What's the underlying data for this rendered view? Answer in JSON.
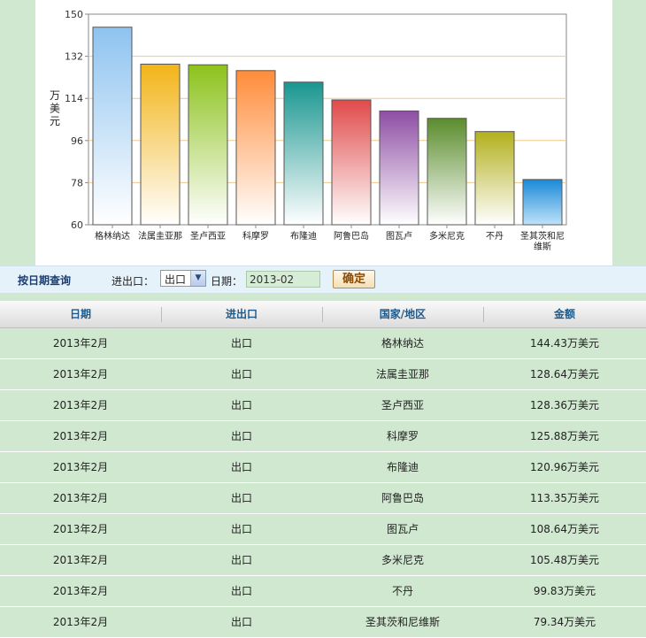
{
  "colors": {
    "bars": [
      "#8ec3f0",
      "#f2b418",
      "#8cc21c",
      "#ff8c3a",
      "#1a9690",
      "#e04a4a",
      "#8e4ea4",
      "#5a8c2c",
      "#b2b01c",
      "#1a8ad8"
    ]
  },
  "chart_data": {
    "type": "bar",
    "ylabel": "万美元",
    "ylim": [
      60,
      150
    ],
    "yticks": [
      60,
      78,
      96,
      114,
      132,
      150
    ],
    "grid": true,
    "categories": [
      "格林纳达",
      "法属圭亚那",
      "圣卢西亚",
      "科摩罗",
      "布隆迪",
      "阿鲁巴岛",
      "图瓦卢",
      "多米尼克",
      "不丹",
      "圣其茨和尼维斯"
    ],
    "values": [
      144.43,
      128.64,
      128.36,
      125.88,
      120.96,
      113.35,
      108.64,
      105.48,
      99.83,
      79.34
    ]
  },
  "query": {
    "title": "按日期查询",
    "io_label": "进出口：",
    "io_selected": "出口",
    "date_label": "日期：",
    "date_value": "2013-02",
    "confirm_label": "确定"
  },
  "table": {
    "headers": [
      "日期",
      "进出口",
      "国家/地区",
      "金额"
    ],
    "rows": [
      [
        "2013年2月",
        "出口",
        "格林纳达",
        "144.43万美元"
      ],
      [
        "2013年2月",
        "出口",
        "法属圭亚那",
        "128.64万美元"
      ],
      [
        "2013年2月",
        "出口",
        "圣卢西亚",
        "128.36万美元"
      ],
      [
        "2013年2月",
        "出口",
        "科摩罗",
        "125.88万美元"
      ],
      [
        "2013年2月",
        "出口",
        "布隆迪",
        "120.96万美元"
      ],
      [
        "2013年2月",
        "出口",
        "阿鲁巴岛",
        "113.35万美元"
      ],
      [
        "2013年2月",
        "出口",
        "图瓦卢",
        "108.64万美元"
      ],
      [
        "2013年2月",
        "出口",
        "多米尼克",
        "105.48万美元"
      ],
      [
        "2013年2月",
        "出口",
        "不丹",
        "99.83万美元"
      ],
      [
        "2013年2月",
        "出口",
        "圣其茨和尼维斯",
        "79.34万美元"
      ]
    ]
  }
}
